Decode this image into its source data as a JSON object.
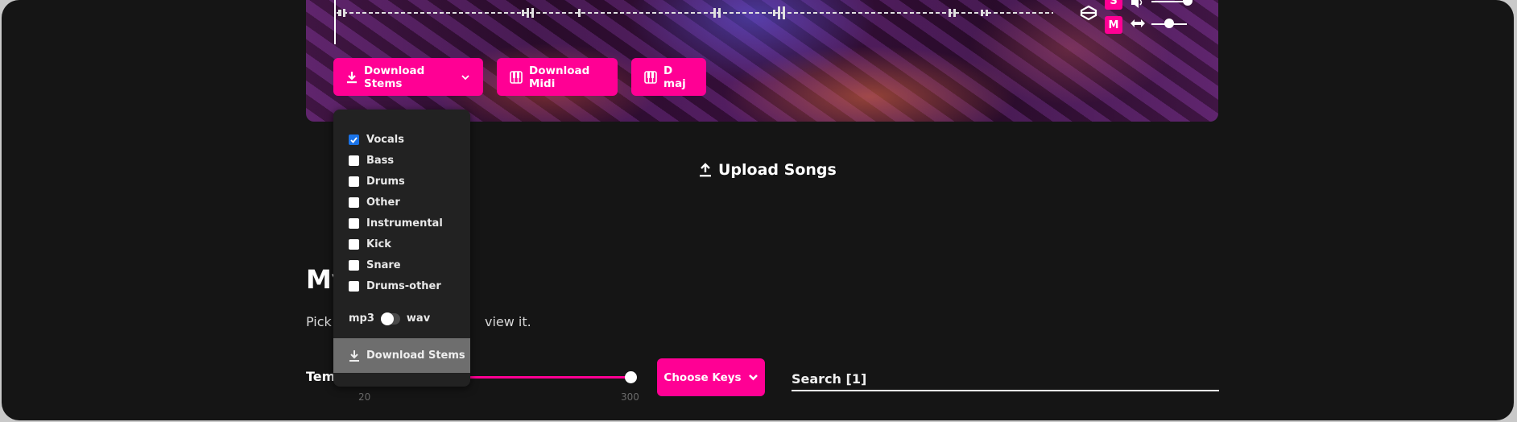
{
  "hero": {
    "solo_label": "S",
    "mute_label": "M",
    "volume_level": 0.85,
    "pan_level": 0.45,
    "buttons": {
      "download_stems": "Download Stems",
      "download_midi": "Download Midi",
      "key": "D maj"
    }
  },
  "stems_dropdown": {
    "items": [
      {
        "label": "Vocals",
        "checked": true
      },
      {
        "label": "Bass",
        "checked": false
      },
      {
        "label": "Drums",
        "checked": false
      },
      {
        "label": "Other",
        "checked": false
      },
      {
        "label": "Instrumental",
        "checked": false
      },
      {
        "label": "Kick",
        "checked": false
      },
      {
        "label": "Snare",
        "checked": false
      },
      {
        "label": "Drums-other",
        "checked": false
      }
    ],
    "format_left": "mp3",
    "format_right": "wav",
    "format_selected": "mp3",
    "download_label": "Download Stems"
  },
  "upload": {
    "label": "Upload Songs"
  },
  "library": {
    "heading_visible": "My",
    "description_left_visible": "Pick",
    "description_right_visible": "view it.",
    "tempo_label_visible": "Tem",
    "tempo_min": "20",
    "tempo_max": "300",
    "tempo_range_fraction": [
      0,
      1
    ],
    "choose_keys_label": "Choose Keys",
    "search_placeholder": "Search [1]"
  }
}
